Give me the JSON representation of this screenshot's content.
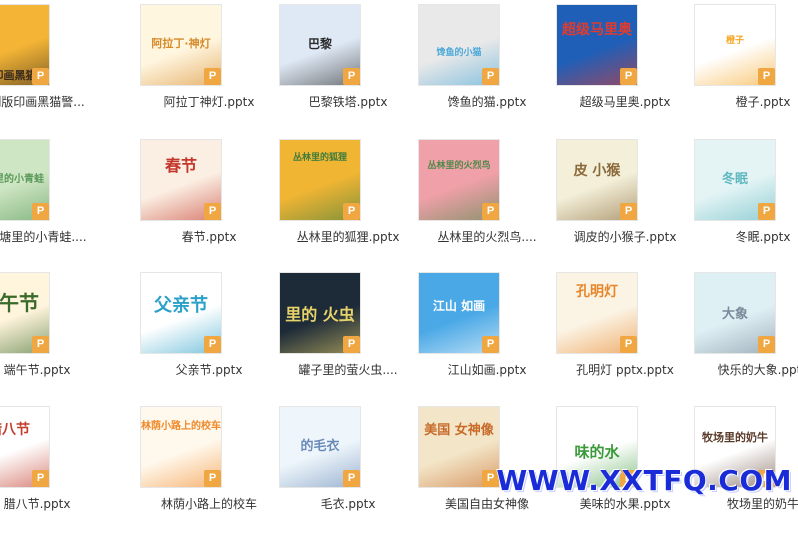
{
  "files": [
    {
      "name": "制版印画黑猫警...",
      "thumb_title": "制版印画黑猫警",
      "badge": "P",
      "colors": [
        "#f4b536",
        "#3a2a1c"
      ]
    },
    {
      "name": "阿拉丁神灯.pptx",
      "thumb_title": "阿拉丁·神灯",
      "badge": "P",
      "colors": [
        "#fff6e0",
        "#d78a2a"
      ]
    },
    {
      "name": "巴黎铁塔.pptx",
      "thumb_title": "巴黎",
      "badge": "P",
      "colors": [
        "#dfe9f5",
        "#2b2b2b"
      ]
    },
    {
      "name": "馋鱼的猫.pptx",
      "thumb_title": "馋鱼的小猫",
      "badge": "P",
      "colors": [
        "#e9e9e9",
        "#4aa8d8"
      ]
    },
    {
      "name": "超级马里奥.pptx",
      "thumb_title": "超级马里奥",
      "badge": "P",
      "colors": [
        "#1f5fb8",
        "#e23b2e"
      ]
    },
    {
      "name": "橙子.pptx",
      "thumb_title": "橙子",
      "badge": "P",
      "colors": [
        "#ffffff",
        "#f5a623"
      ]
    },
    {
      "name": "池塘里的小青蛙....",
      "thumb_title": "荷塘里的小青蛙",
      "badge": "P",
      "colors": [
        "#cfe6c4",
        "#5a9a5a"
      ]
    },
    {
      "name": "春节.pptx",
      "thumb_title": "春节",
      "badge": "P",
      "colors": [
        "#fbeee2",
        "#c4372b"
      ]
    },
    {
      "name": "丛林里的狐狸.pptx",
      "thumb_title": "丛林里的狐狸",
      "badge": "P",
      "colors": [
        "#f1b534",
        "#3f7c3b"
      ]
    },
    {
      "name": "丛林里的火烈鸟....",
      "thumb_title": "丛林里的火烈鸟",
      "badge": "P",
      "colors": [
        "#f0a0a8",
        "#4f8a4a"
      ]
    },
    {
      "name": "调皮的小猴子.pptx",
      "thumb_title": "皮 小猴",
      "badge": "P",
      "colors": [
        "#f3efd9",
        "#8a6a3a"
      ]
    },
    {
      "name": "冬眠.pptx",
      "thumb_title": "冬眠",
      "badge": "P",
      "colors": [
        "#e4f4f5",
        "#5fb8c0"
      ]
    },
    {
      "name": "端午节.pptx",
      "thumb_title": "端午节",
      "badge": "P",
      "colors": [
        "#fff4dc",
        "#3a6a2a"
      ]
    },
    {
      "name": "父亲节.pptx",
      "thumb_title": "父亲节",
      "badge": "P",
      "colors": [
        "#ffffff",
        "#2ba0c8"
      ]
    },
    {
      "name": "罐子里的萤火虫....",
      "thumb_title": "里的 火虫",
      "badge": "P",
      "colors": [
        "#1d2a38",
        "#e8d36a"
      ]
    },
    {
      "name": "江山如画.pptx",
      "thumb_title": "江山 如画",
      "badge": "P",
      "colors": [
        "#4aa8e6",
        "#ffffff"
      ]
    },
    {
      "name": "孔明灯 pptx.pptx",
      "thumb_title": "孔明灯",
      "badge": "P",
      "colors": [
        "#fbf3e4",
        "#e8862a"
      ]
    },
    {
      "name": "快乐的大象.pptx",
      "thumb_title": "大象",
      "badge": "P",
      "colors": [
        "#dff0f5",
        "#7a8a9a"
      ]
    },
    {
      "name": "腊八节.pptx",
      "thumb_title": "腊八节",
      "badge": "P",
      "colors": [
        "#ffffff",
        "#c23a2a"
      ]
    },
    {
      "name": "林荫小路上的校车",
      "thumb_title": "林荫小路上的校车",
      "badge": "P",
      "colors": [
        "#fff8ec",
        "#f08a2a"
      ]
    },
    {
      "name": "毛衣.pptx",
      "thumb_title": "的毛衣",
      "badge": "P",
      "colors": [
        "#eef6fb",
        "#6a8ab8"
      ]
    },
    {
      "name": "美国自由女神像",
      "thumb_title": "美国 女神像",
      "badge": "P",
      "colors": [
        "#f3e6c8",
        "#c86a2a"
      ]
    },
    {
      "name": "美味的水果.pptx",
      "thumb_title": "味的水",
      "badge": "P",
      "colors": [
        "#ffffff",
        "#3a9a3a"
      ]
    },
    {
      "name": "牧场里的奶牛",
      "thumb_title": "牧场里的奶牛",
      "badge": "P",
      "colors": [
        "#ffffff",
        "#5a3a2a"
      ]
    }
  ],
  "watermark": "WWW.XXTFQ.COM"
}
